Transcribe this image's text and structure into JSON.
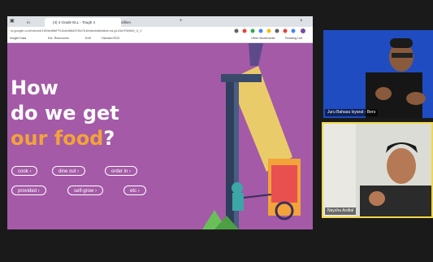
{
  "browser": {
    "tabs": [
      {
        "label": "m"
      },
      {
        "label": "(4) 4 Grade ELL - Tough 4"
      },
      {
        "label": "Sillien"
      }
    ],
    "new_tab": "+",
    "url": "sr.google.com/view/d/1KMwtMbFFUIc6d8bd3Y5a7b1bfdw/edit#slide=id.g1c9a7f3e5b0_0_0",
    "bookmarks": [
      "Insight Data",
      "Ext. Resources",
      "EdX",
      "Harvard EDX"
    ],
    "bookmark_right": [
      "Other Bookmarks",
      "Reading List"
    ]
  },
  "slide": {
    "title_line1": "How",
    "title_line2": "do we get",
    "title_accent": "our food",
    "title_end": "?",
    "chips": [
      "cook",
      "dine out",
      "order in",
      "provided",
      "self-grow",
      "etc"
    ]
  },
  "video": {
    "participant1_name": "Juru Bahasa Isyarat - Bers",
    "participant2_name": "Naysha Ardital"
  },
  "colors": {
    "slide_bg": "#a45aa7",
    "accent": "#f2a33a",
    "speaker_border": "#f0d84a",
    "video1_bg": "#1f4cc0"
  }
}
